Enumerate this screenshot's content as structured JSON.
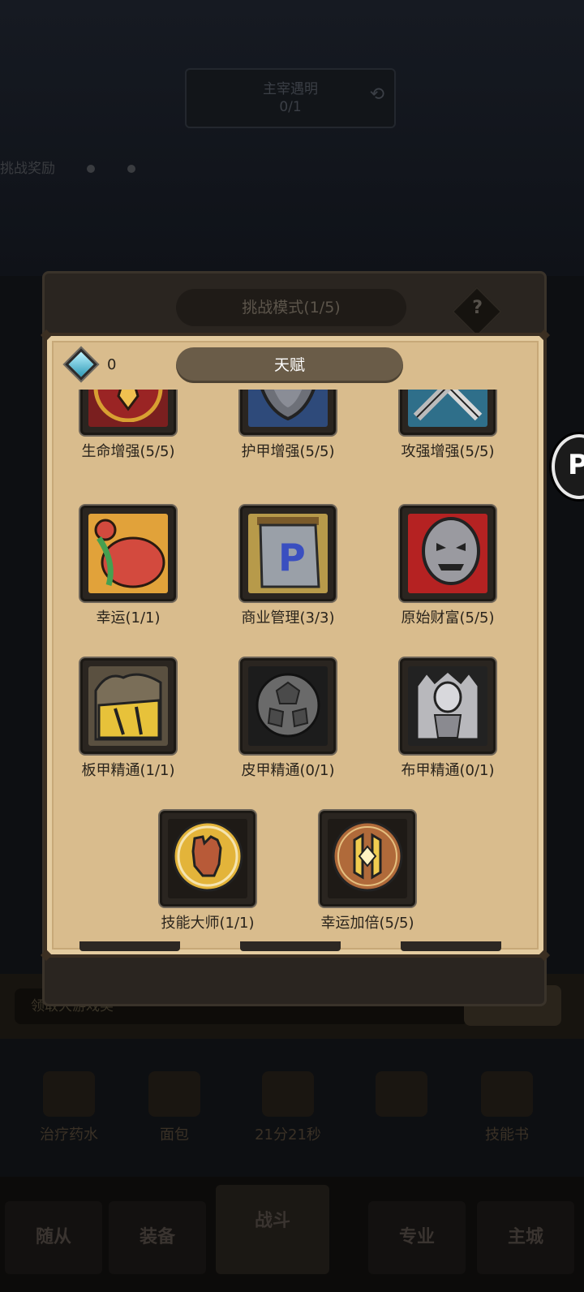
{
  "background": {
    "banner": {
      "title": "主宰遇明",
      "progress": "0/1"
    },
    "reward_text": "挑战奖励",
    "bottom_field_text": "领取大游戏奖",
    "items": [
      {
        "label": "治疗药水"
      },
      {
        "label": "面包"
      },
      {
        "label": "21分21秒"
      },
      {
        "label": ""
      },
      {
        "label": "技能书"
      }
    ],
    "nav": [
      {
        "label": "随从"
      },
      {
        "label": "装备"
      },
      {
        "label": "战斗"
      },
      {
        "label": "专业"
      },
      {
        "label": "主城"
      }
    ],
    "side_button_glyph": "P"
  },
  "challenge_panel": {
    "title": "挑战模式(1/5)",
    "help_glyph": "?"
  },
  "talent_panel": {
    "title": "天赋",
    "gem_count": "0",
    "talents": [
      {
        "id": "hp",
        "label": "生命增强(5/5)",
        "icon": "blood-drop-icon"
      },
      {
        "id": "armor",
        "label": "护甲增强(5/5)",
        "icon": "shield-icon"
      },
      {
        "id": "attack",
        "label": "攻强增强(5/5)",
        "icon": "crossed-swords-icon"
      },
      {
        "id": "luck",
        "label": "幸运(1/1)",
        "icon": "money-bag-icon"
      },
      {
        "id": "commerce",
        "label": "商业管理(3/3)",
        "icon": "banner-scroll-icon"
      },
      {
        "id": "wealth",
        "label": "原始财富(5/5)",
        "icon": "skull-mask-icon"
      },
      {
        "id": "plate",
        "label": "板甲精通(1/1)",
        "icon": "plate-armor-icon"
      },
      {
        "id": "leather",
        "label": "皮甲精通(0/1)",
        "icon": "leather-armor-icon"
      },
      {
        "id": "cloth",
        "label": "布甲精通(0/1)",
        "icon": "cloth-armor-icon"
      },
      {
        "id": "skillmaster",
        "label": "技能大师(1/1)",
        "icon": "fist-medallion-icon"
      },
      {
        "id": "luckdouble",
        "label": "幸运加倍(5/5)",
        "icon": "coin-medallion-icon"
      }
    ]
  }
}
